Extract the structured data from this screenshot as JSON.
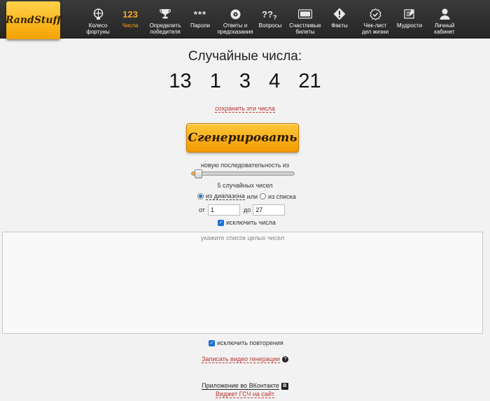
{
  "nav": {
    "logo": "RandStuff",
    "items": [
      {
        "label": "Колесо\nфортуны",
        "icon": "wheel-icon",
        "active": false
      },
      {
        "label": "Числа",
        "icon": "numbers-icon",
        "icon_text": "123",
        "active": true
      },
      {
        "label": "Определить\nпобедителя",
        "icon": "trophy-icon",
        "active": false
      },
      {
        "label": "Пароли",
        "icon": "password-icon",
        "icon_text": "***",
        "active": false
      },
      {
        "label": "Ответы и\nпредсказания",
        "icon": "ball-icon",
        "active": false
      },
      {
        "label": "Вопросы",
        "icon": "question-icon",
        "icon_text": "??",
        "active": false
      },
      {
        "label": "Счастливые\nбилеты",
        "icon": "ticket-icon",
        "active": false
      },
      {
        "label": "Факты",
        "icon": "fact-icon",
        "active": false
      },
      {
        "label": "Чек-лист\nдел жизни",
        "icon": "checklist-icon",
        "active": false
      },
      {
        "label": "Мудрости",
        "icon": "wisdom-icon",
        "active": false
      },
      {
        "label": "Личный\nкабинет",
        "icon": "user-icon",
        "active": false
      }
    ]
  },
  "main": {
    "title": "Случайные числа:",
    "numbers": [
      "13",
      "1",
      "3",
      "4",
      "21"
    ],
    "save_link": "сохранить эти числа",
    "generate_button": "Сгенерировать",
    "sequence_label": "новую последовательность из",
    "slider_level": 5,
    "count_label": "5 случайных чисел",
    "mode": {
      "range_label": "из диапазона",
      "or_text": "или",
      "list_label": "из списка",
      "selected": "range"
    },
    "from_label": "от",
    "from_value": "1",
    "to_label": "до",
    "to_value": "27",
    "exclude_numbers_label": "исключить числа",
    "exclude_numbers_checked": true,
    "exclude_list_placeholder": "укажите список целых чисел",
    "exclude_repeats_label": "исключить повторения",
    "exclude_repeats_checked": true,
    "video_link": "Записать видео генерации",
    "vk_app_link": "Приложение во ВКонтакте",
    "vk_icon": "В",
    "widget_link": "Виджет ГСЧ на сайт"
  },
  "colors": {
    "accent": "#f5a623",
    "link": "#bb3333",
    "topbar": "#2e2e2e"
  }
}
